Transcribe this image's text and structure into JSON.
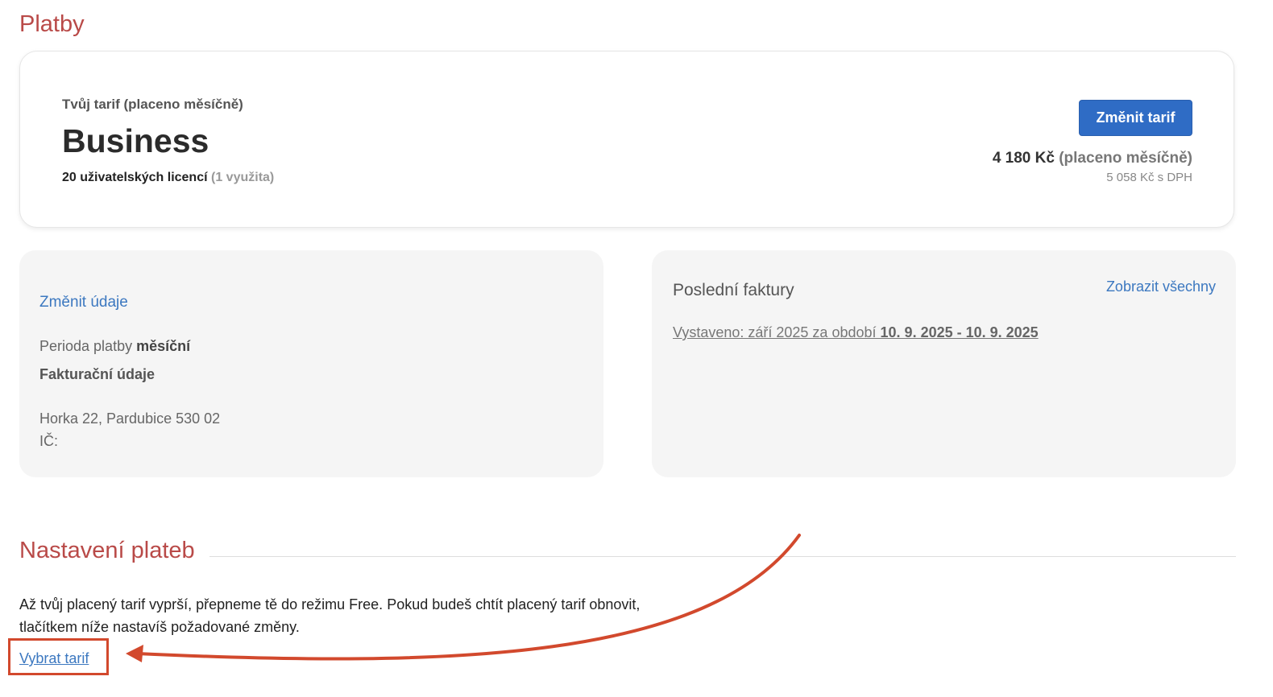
{
  "page": {
    "title": "Platby"
  },
  "plan": {
    "label": "Tvůj tarif (placeno měsíčně)",
    "name": "Business",
    "licenses": "20 uživatelských licencí",
    "licenses_used": "(1 využita)",
    "change_button": "Změnit tarif",
    "price": "4 180 Kč",
    "price_period": "(placeno měsíčně)",
    "price_vat": "5 058 Kč s DPH"
  },
  "billing": {
    "edit_link": "Změnit údaje",
    "period_label": "Perioda platby",
    "period_value": "měsíční",
    "title": "Fakturační údaje",
    "address": "Horka 22, Pardubice 530 02",
    "ic_label": "IČ:"
  },
  "invoices": {
    "title": "Poslední faktury",
    "show_all": "Zobrazit všechny",
    "items": [
      {
        "issued": "Vystaveno: září 2025 za období",
        "period": "10. 9. 2025 - 10. 9. 2025"
      }
    ]
  },
  "settings": {
    "title": "Nastavení plateb",
    "text": "Až tvůj placený tarif vyprší, přepneme tě do režimu Free. Pokud budeš chtít placený tarif obnovit, tlačítkem níže nastavíš požadované změny.",
    "select_link": "Vybrat tarif"
  },
  "colors": {
    "heading": "#b94a48",
    "primary": "#2f6cc5",
    "link": "#3c78c0",
    "annotation": "#d2492d",
    "panel": "#f5f5f5"
  }
}
